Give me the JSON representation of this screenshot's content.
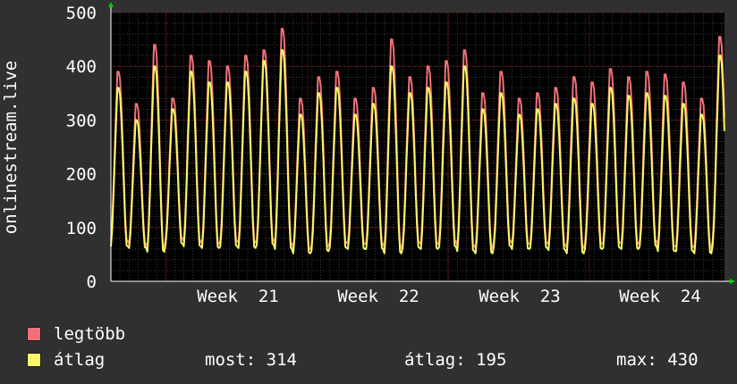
{
  "chart_data": {
    "type": "area",
    "ylabel": "onlinestream.live",
    "ylim": [
      0,
      500
    ],
    "yticks": [
      0,
      100,
      200,
      300,
      400,
      500
    ],
    "xlabels": [
      "Week  21",
      "Week  22",
      "Week  23",
      "Week  24"
    ],
    "grid": true,
    "series": [
      {
        "name": "legtöbb",
        "color": "#f07078",
        "daily_peaks": [
          390,
          330,
          440,
          340,
          420,
          410,
          400,
          420,
          430,
          470,
          340,
          380,
          390,
          340,
          360,
          450,
          380,
          400,
          410,
          430,
          350,
          390,
          340,
          350,
          360,
          380,
          370,
          395,
          380,
          390,
          385,
          370,
          340,
          455
        ],
        "daily_lows": [
          75,
          70,
          60,
          80,
          75,
          70,
          75,
          72,
          78,
          70,
          60,
          65,
          72,
          70,
          70,
          62,
          72,
          70,
          74,
          66,
          62,
          75,
          70,
          72,
          68,
          62,
          70,
          72,
          70,
          75,
          65,
          65,
          62,
          75
        ]
      },
      {
        "name": "átlag",
        "color": "#f8f868",
        "daily_peaks": [
          360,
          300,
          400,
          320,
          390,
          370,
          370,
          390,
          410,
          430,
          310,
          350,
          360,
          310,
          330,
          400,
          350,
          360,
          370,
          400,
          320,
          350,
          310,
          320,
          330,
          340,
          330,
          360,
          345,
          350,
          345,
          330,
          310,
          420
        ],
        "daily_lows": [
          65,
          62,
          55,
          70,
          65,
          62,
          65,
          62,
          68,
          60,
          52,
          56,
          62,
          60,
          60,
          52,
          62,
          60,
          64,
          56,
          52,
          65,
          60,
          62,
          58,
          52,
          60,
          62,
          60,
          65,
          56,
          56,
          52,
          65
        ]
      }
    ],
    "legend": [
      {
        "label": "legtöbb",
        "color": "#f07078"
      },
      {
        "label": "átlag",
        "color": "#f8f868"
      }
    ],
    "stats": {
      "most_label": "most:",
      "most_value": "314",
      "atlag_label": "átlag:",
      "atlag_value": "195",
      "max_label": "max:",
      "max_value": "430"
    }
  }
}
